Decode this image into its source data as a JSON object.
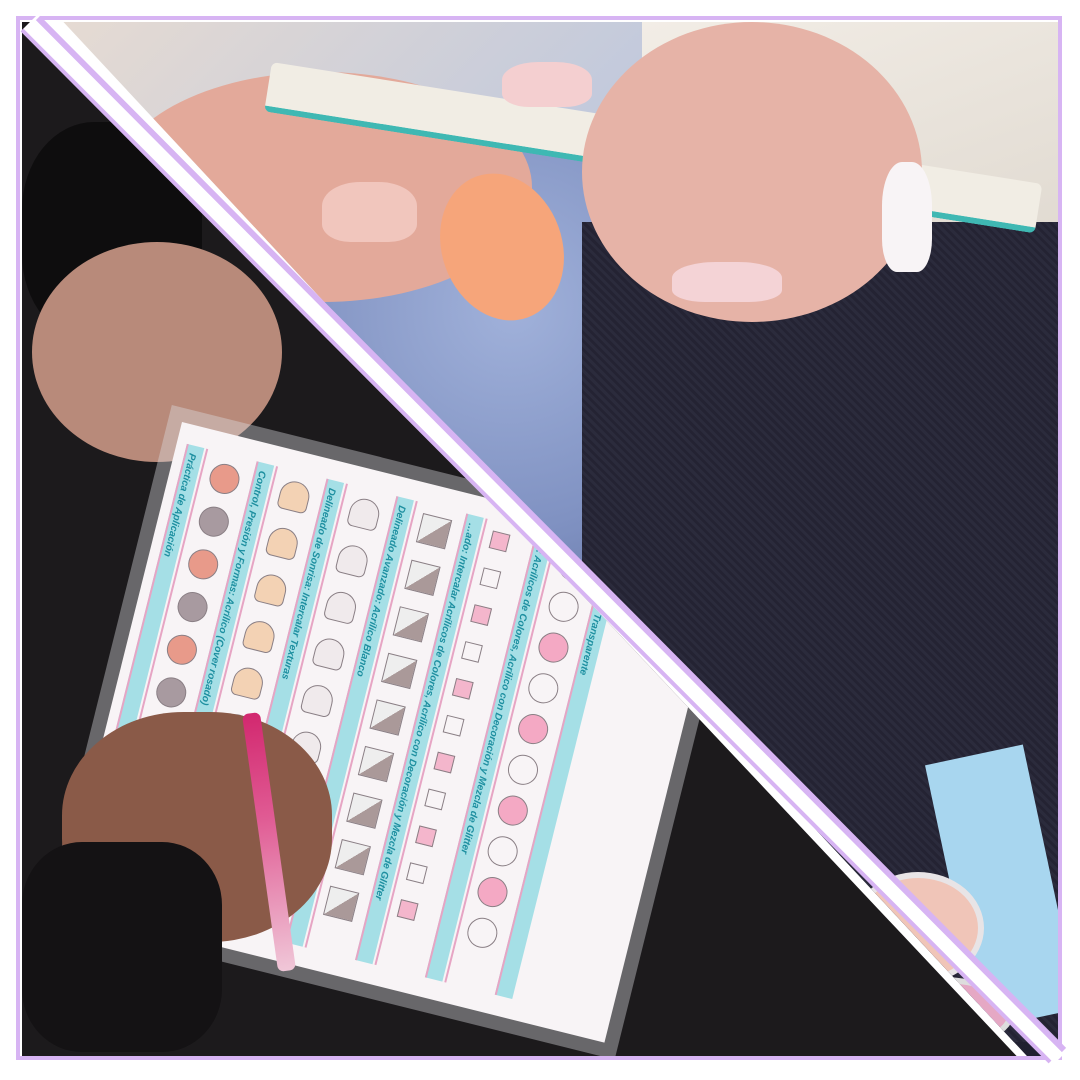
{
  "photo_top": {
    "description_icon": "hands-filing-nails-photo"
  },
  "practice_sheet": {
    "columns": [
      {
        "title": "Práctica de Aplicación"
      },
      {
        "title": "Control, Presión y Formas: Acrílico (Cover rosado)"
      },
      {
        "title": "Delineado de Sonrisa: Intercalar Texturas"
      },
      {
        "title": "Delineado Avanzado: Acrílico Blanco"
      },
      {
        "title": "…ado: Intercalar Acrílicos de Colores, Acrílico con Decoración y Mezcla de Glitter"
      },
      {
        "title": "…: Acrílicos de Colores, Acrílico con Decoración y Mezcla de Glitter"
      },
      {
        "title": "…e Acrílico Transparente"
      }
    ]
  },
  "colors": {
    "frame": "#d7b4f3",
    "accent_teal": "#1d8fa0",
    "pink": "#e6a5c4"
  }
}
